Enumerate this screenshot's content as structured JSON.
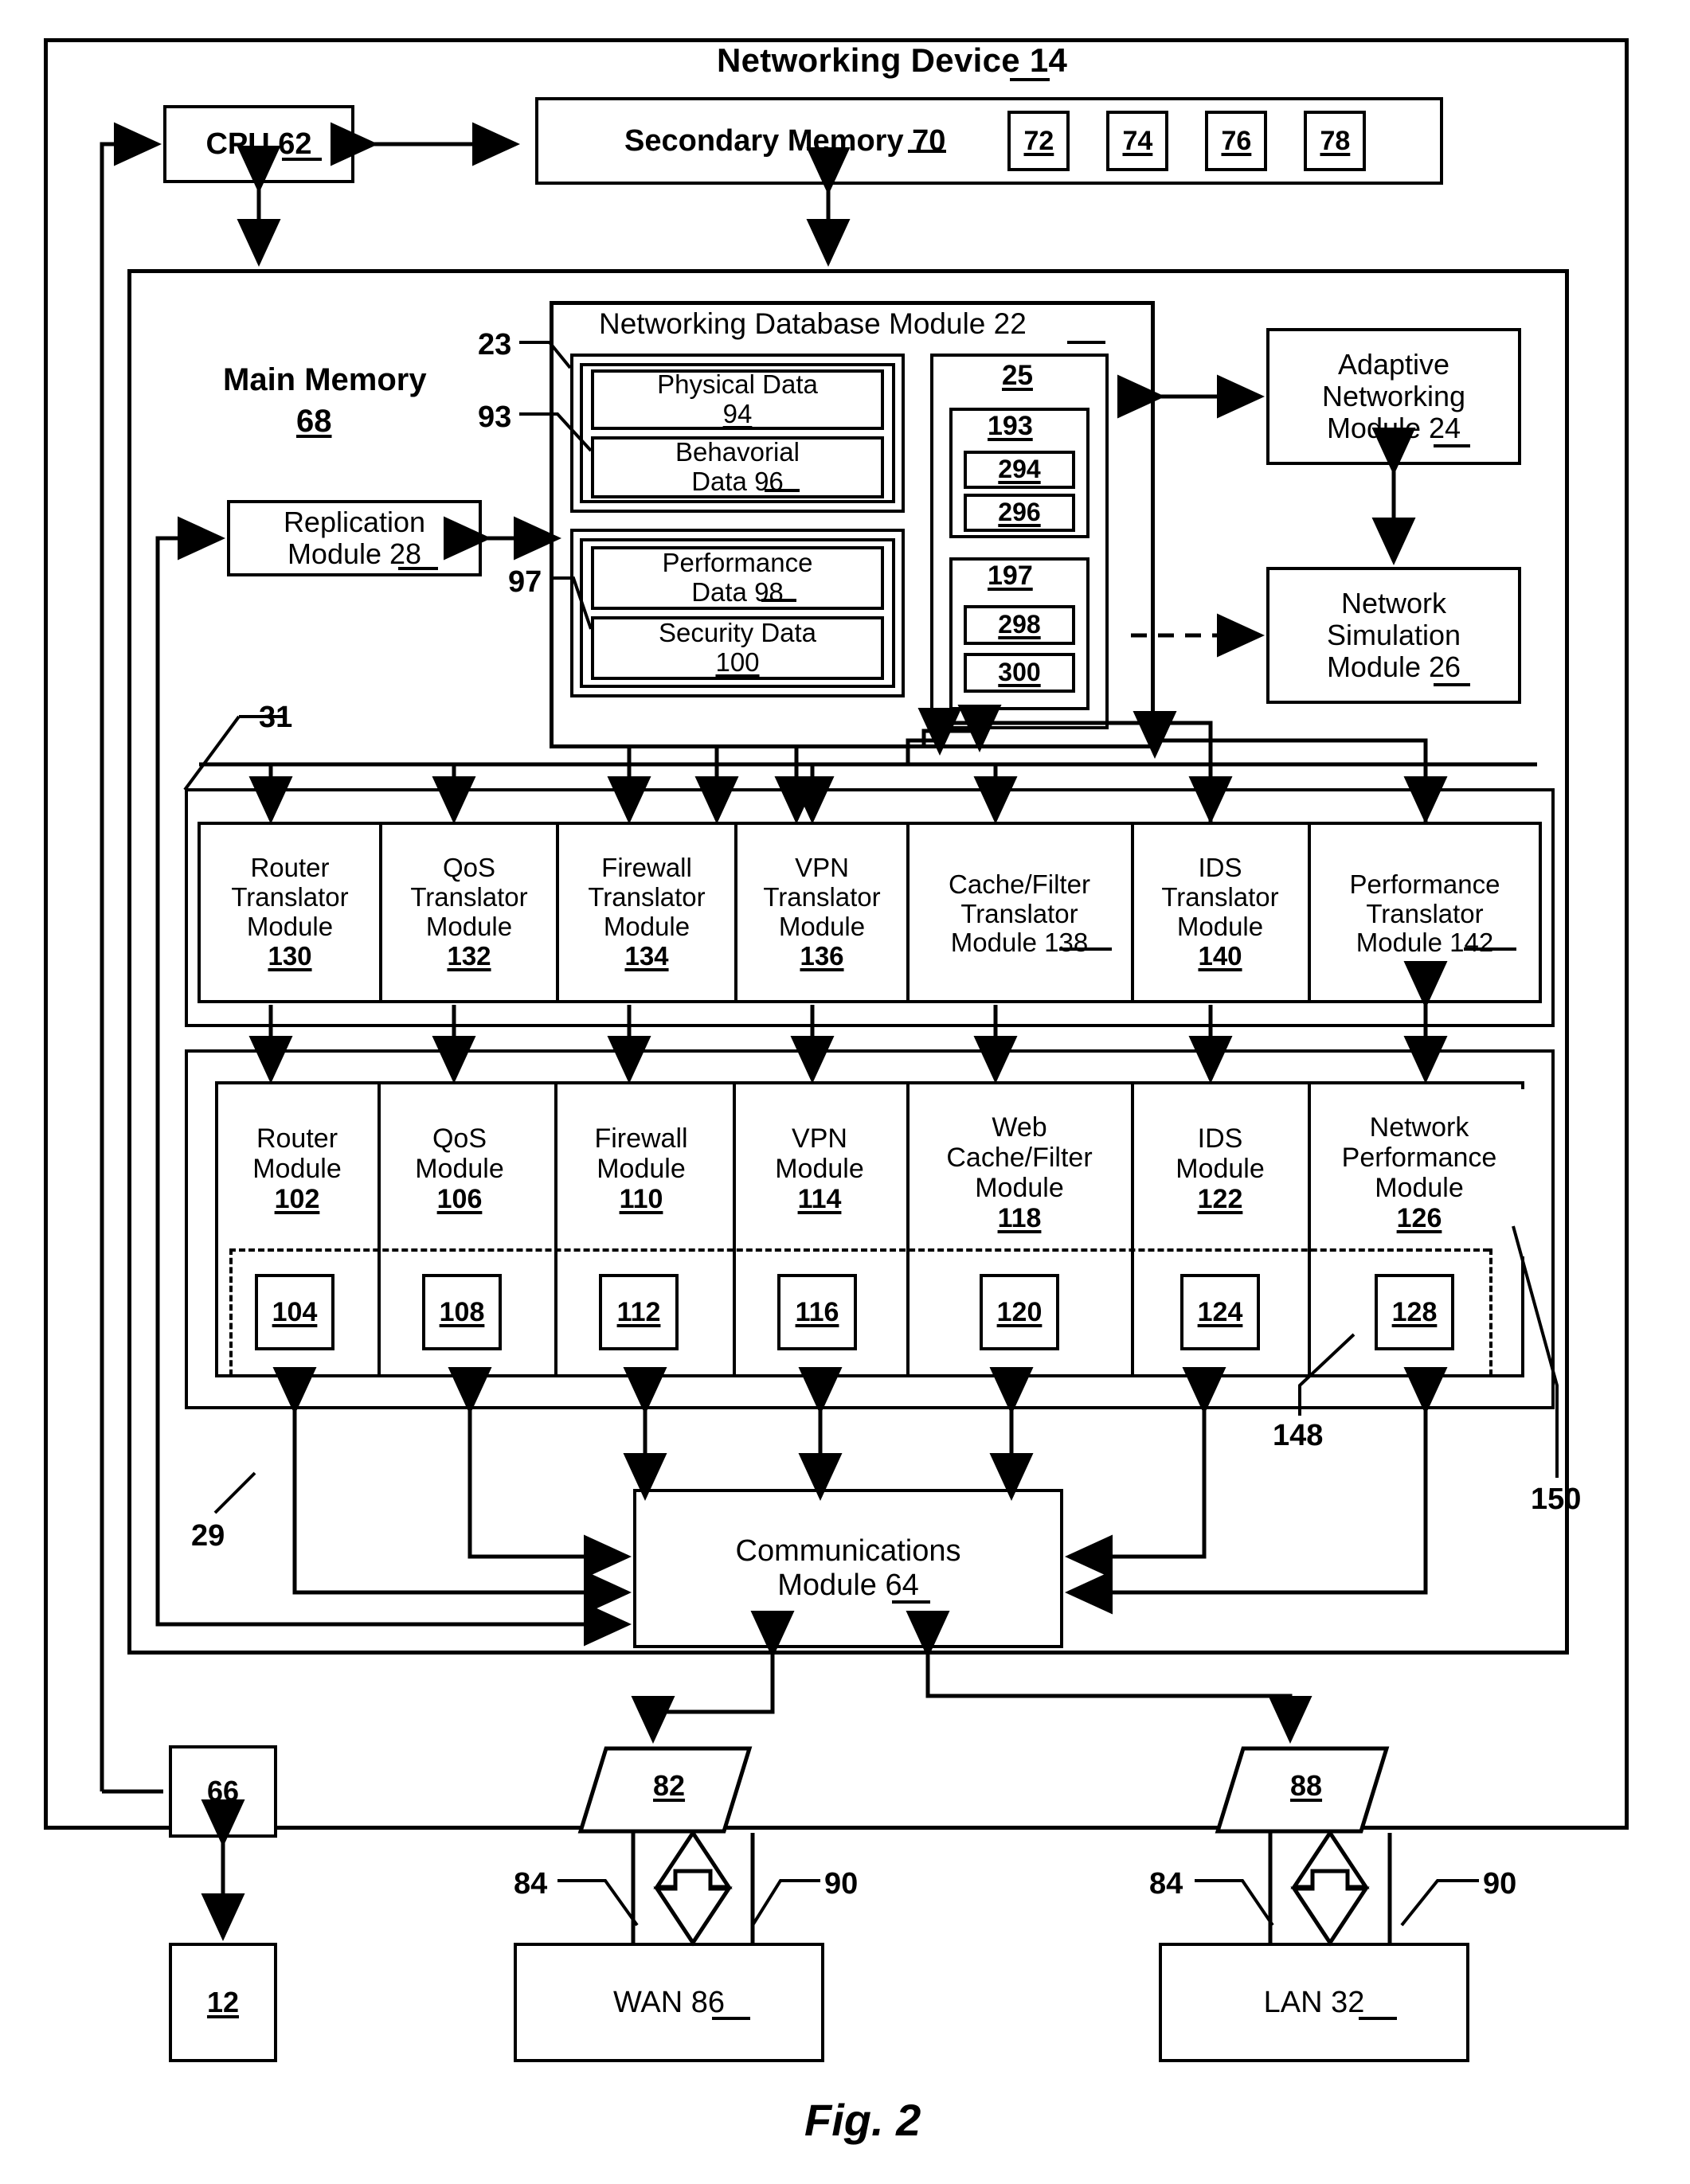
{
  "figure": {
    "caption": "Fig. 2",
    "title": "Networking Device 14"
  },
  "top_row": {
    "cpu": "CPU 62",
    "secondary_memory": "Secondary Memory 70",
    "secondary_memory_boxes": [
      "72",
      "74",
      "76",
      "78"
    ]
  },
  "main_memory": {
    "label_line1": "Main Memory",
    "label_line2": "68",
    "replication_module": {
      "line1": "Replication",
      "line2": "Module 28"
    },
    "ref_23": "23",
    "ref_93": "93",
    "ref_97": "97",
    "ref_31": "31",
    "ref_29": "29",
    "ref_148": "148",
    "ref_150": "150"
  },
  "database_module": {
    "title": "Networking Database Module 22",
    "group_93": [
      {
        "line1": "Physical Data",
        "line2": "94"
      },
      {
        "line1": "Behavorial",
        "line2": "Data 96"
      }
    ],
    "group_97": [
      {
        "line1": "Performance",
        "line2": "Data 98"
      },
      {
        "line1": "Security Data",
        "line2": "100"
      }
    ],
    "column_25": {
      "header": "25",
      "groups": [
        {
          "header": "193",
          "items": [
            "294",
            "296"
          ]
        },
        {
          "header": "197",
          "items": [
            "298",
            "300"
          ]
        }
      ]
    }
  },
  "right_modules": [
    {
      "lines": [
        "Adaptive",
        "Networking",
        "Module 24"
      ]
    },
    {
      "lines": [
        "Network",
        "Simulation",
        "Module 26"
      ]
    }
  ],
  "translator_row": [
    {
      "lines": [
        "Router",
        "Translator",
        "Module",
        "130"
      ]
    },
    {
      "lines": [
        "QoS",
        "Translator",
        "Module",
        "132"
      ]
    },
    {
      "lines": [
        "Firewall",
        "Translator",
        "Module",
        "134"
      ]
    },
    {
      "lines": [
        "VPN",
        "Translator",
        "Module",
        "136"
      ]
    },
    {
      "lines": [
        "Cache/Filter",
        "Translator",
        "Module 138"
      ]
    },
    {
      "lines": [
        "IDS",
        "Translator",
        "Module",
        "140"
      ]
    },
    {
      "lines": [
        "Performance",
        "Translator",
        "Module 142"
      ]
    }
  ],
  "module_row": [
    {
      "lines": [
        "Router",
        "Module",
        "102"
      ],
      "sub": "104"
    },
    {
      "lines": [
        "QoS",
        "Module",
        "106"
      ],
      "sub": "108"
    },
    {
      "lines": [
        "Firewall",
        "Module",
        "110"
      ],
      "sub": "112"
    },
    {
      "lines": [
        "VPN",
        "Module",
        "114"
      ],
      "sub": "116"
    },
    {
      "lines": [
        "Web",
        "Cache/Filter",
        "Module",
        "118"
      ],
      "sub": "120"
    },
    {
      "lines": [
        "IDS",
        "Module",
        "122"
      ],
      "sub": "124"
    },
    {
      "lines": [
        "Network",
        "Performance",
        "Module",
        "126"
      ],
      "sub": "128"
    }
  ],
  "communications_module": {
    "line1": "Communications",
    "line2": "Module  64"
  },
  "bottom": {
    "box_66": "66",
    "box_12": "12",
    "port_82": "82",
    "port_88": "88",
    "wan": "WAN 86",
    "lan": "LAN 32",
    "ref_84_left": "84",
    "ref_90_left": "90",
    "ref_84_right": "84",
    "ref_90_right": "90"
  }
}
